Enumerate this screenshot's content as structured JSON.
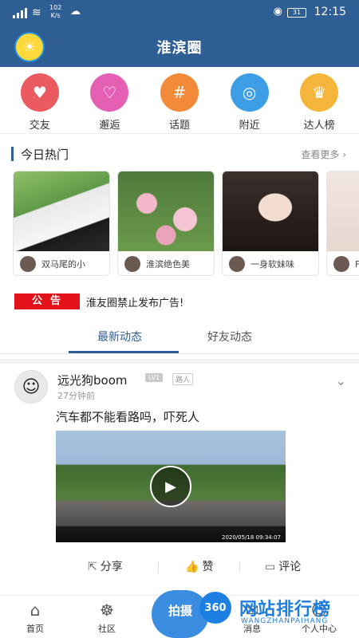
{
  "status": {
    "net_speed": "102\nK/s",
    "battery": "31",
    "time": "12:15"
  },
  "header": {
    "title": "淮滨圈"
  },
  "categories": [
    {
      "label": "交友",
      "icon": "heart-icon",
      "color": "#ea5a60"
    },
    {
      "label": "邂逅",
      "icon": "heartbeat-icon",
      "color": "#e55fb4"
    },
    {
      "label": "话题",
      "icon": "hashtag-icon",
      "color": "#f28a3a"
    },
    {
      "label": "附近",
      "icon": "location-icon",
      "color": "#3d9ee6"
    },
    {
      "label": "达人榜",
      "icon": "crown-icon",
      "color": "#f5b53b"
    }
  ],
  "hot": {
    "title": "今日热门",
    "more": "查看更多",
    "cards": [
      {
        "name": "双马尾的小"
      },
      {
        "name": "淮滨绝色美"
      },
      {
        "name": "一身软妹味"
      },
      {
        "name": "F"
      }
    ]
  },
  "notice": {
    "tag": "公告",
    "text": "淮友圈禁止发布广告!"
  },
  "tabs": [
    {
      "label": "最新动态"
    },
    {
      "label": "好友动态"
    }
  ],
  "post": {
    "username": "远光狗boom",
    "level": "LV1",
    "role": "路人",
    "time": "27分钟前",
    "content": "汽车都不能看路吗，吓死人",
    "video_timestamp": "2020/05/18  09:34:07",
    "actions": {
      "share": "分享",
      "like": "赞",
      "comment": "评论"
    }
  },
  "bottom_nav": {
    "home": "首页",
    "community": "社区",
    "shoot": "拍摄",
    "message": "消息",
    "profile": "个人中心"
  },
  "watermark": {
    "logo": "360",
    "text": "网站排行榜",
    "sub": "WANGZHANPAIHANG"
  }
}
